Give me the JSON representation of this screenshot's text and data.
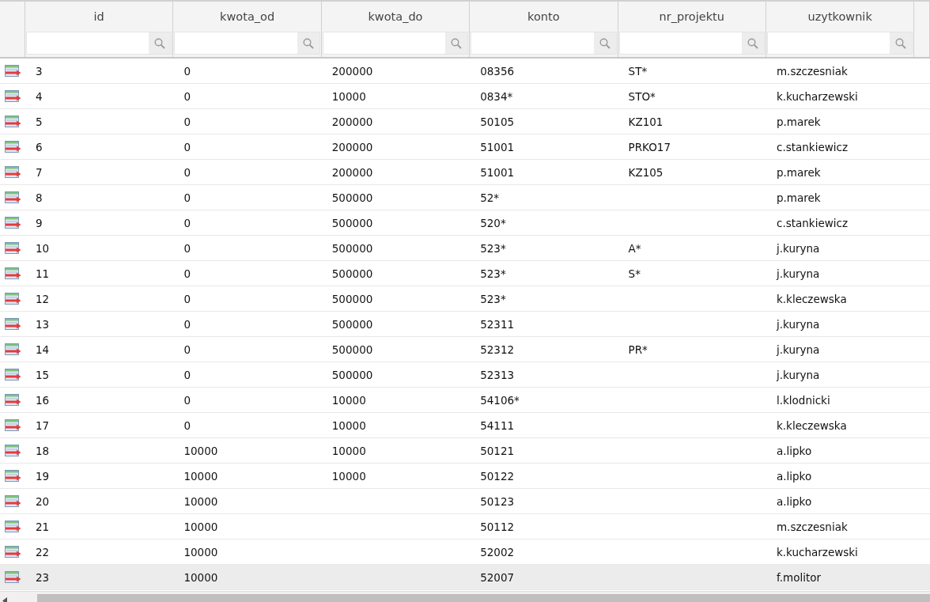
{
  "table": {
    "columns": [
      "id",
      "kwota_od",
      "kwota_do",
      "konto",
      "nr_projektu",
      "uzytkownik"
    ],
    "rows": [
      {
        "cells": [
          "3",
          "0",
          "200000",
          "08356",
          "ST*",
          "m.szczesniak"
        ],
        "selected": false
      },
      {
        "cells": [
          "4",
          "0",
          "10000",
          "0834*",
          "STO*",
          "k.kucharzewski"
        ],
        "selected": false
      },
      {
        "cells": [
          "5",
          "0",
          "200000",
          "50105",
          "KZ101",
          "p.marek"
        ],
        "selected": false
      },
      {
        "cells": [
          "6",
          "0",
          "200000",
          "51001",
          "PRKO17",
          "c.stankiewicz"
        ],
        "selected": false
      },
      {
        "cells": [
          "7",
          "0",
          "200000",
          "51001",
          "KZ105",
          "p.marek"
        ],
        "selected": false
      },
      {
        "cells": [
          "8",
          "0",
          "500000",
          "52*",
          "",
          "p.marek"
        ],
        "selected": false
      },
      {
        "cells": [
          "9",
          "0",
          "500000",
          "520*",
          "",
          "c.stankiewicz"
        ],
        "selected": false
      },
      {
        "cells": [
          "10",
          "0",
          "500000",
          "523*",
          "A*",
          "j.kuryna"
        ],
        "selected": false
      },
      {
        "cells": [
          "11",
          "0",
          "500000",
          "523*",
          "S*",
          "j.kuryna"
        ],
        "selected": false
      },
      {
        "cells": [
          "12",
          "0",
          "500000",
          "523*",
          "",
          "k.kleczewska"
        ],
        "selected": false
      },
      {
        "cells": [
          "13",
          "0",
          "500000",
          "52311",
          "",
          "j.kuryna"
        ],
        "selected": false
      },
      {
        "cells": [
          "14",
          "0",
          "500000",
          "52312",
          "PR*",
          "j.kuryna"
        ],
        "selected": false
      },
      {
        "cells": [
          "15",
          "0",
          "500000",
          "52313",
          "",
          "j.kuryna"
        ],
        "selected": false
      },
      {
        "cells": [
          "16",
          "0",
          "10000",
          "54106*",
          "",
          "l.klodnicki"
        ],
        "selected": false
      },
      {
        "cells": [
          "17",
          "0",
          "10000",
          "54111",
          "",
          "k.kleczewska"
        ],
        "selected": false
      },
      {
        "cells": [
          "18",
          "10000",
          "10000",
          "50121",
          "",
          "a.lipko"
        ],
        "selected": false
      },
      {
        "cells": [
          "19",
          "10000",
          "10000",
          "50122",
          "",
          "a.lipko"
        ],
        "selected": false
      },
      {
        "cells": [
          "20",
          "10000",
          "",
          "50123",
          "",
          "a.lipko"
        ],
        "selected": false
      },
      {
        "cells": [
          "21",
          "10000",
          "",
          "50112",
          "",
          "m.szczesniak"
        ],
        "selected": false
      },
      {
        "cells": [
          "22",
          "10000",
          "",
          "52002",
          "",
          "k.kucharzewski"
        ],
        "selected": false
      },
      {
        "cells": [
          "23",
          "10000",
          "",
          "52007",
          "",
          "f.molitor"
        ],
        "selected": true
      }
    ]
  }
}
